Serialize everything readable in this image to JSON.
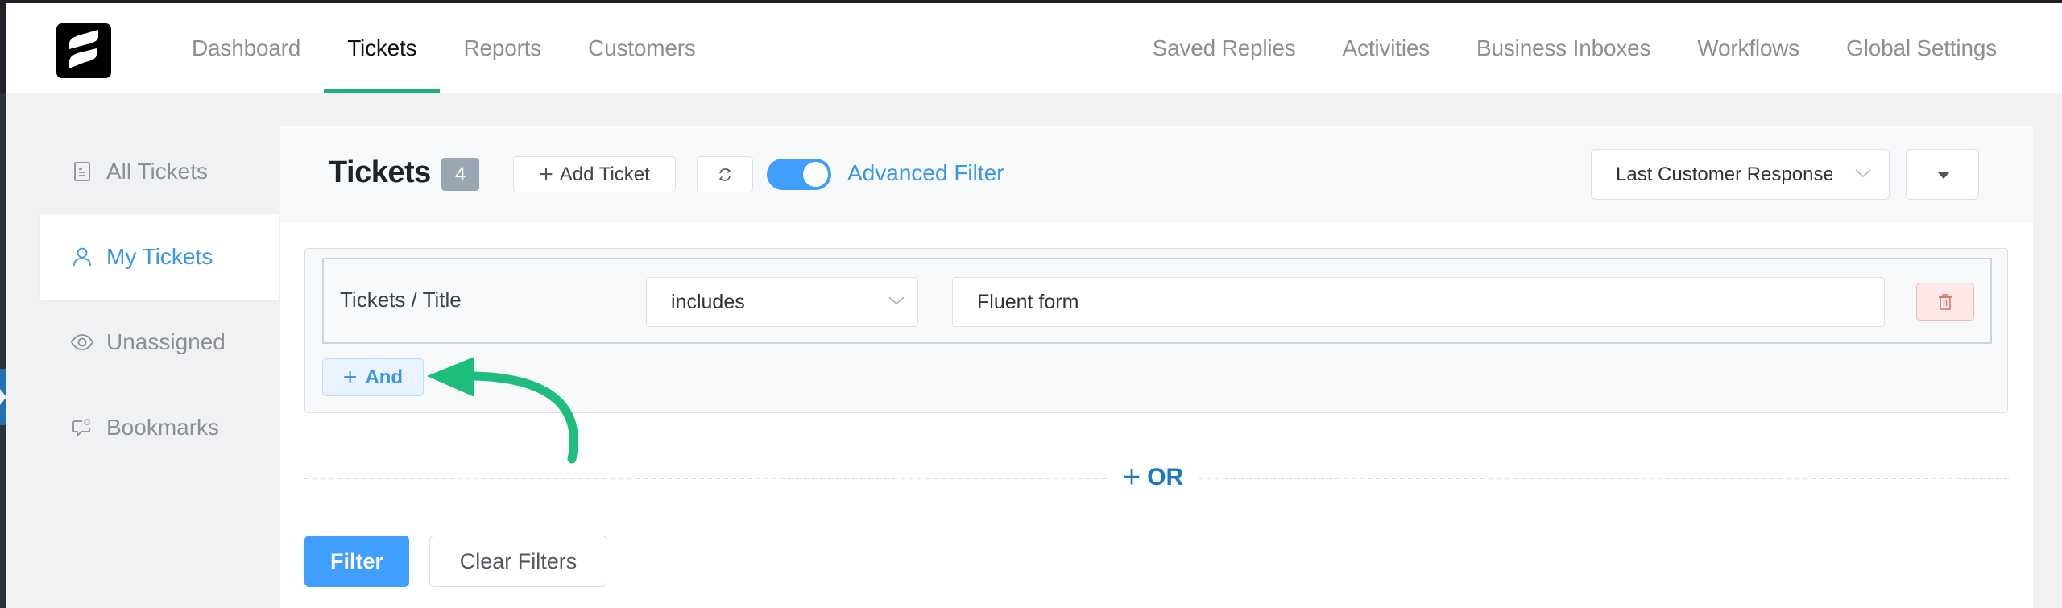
{
  "header": {
    "logo": "fluent-support-logo",
    "nav_left": [
      {
        "label": "Dashboard",
        "active": false
      },
      {
        "label": "Tickets",
        "active": true
      },
      {
        "label": "Reports",
        "active": false
      },
      {
        "label": "Customers",
        "active": false
      }
    ],
    "nav_right": [
      {
        "label": "Saved Replies"
      },
      {
        "label": "Activities"
      },
      {
        "label": "Business Inboxes"
      },
      {
        "label": "Workflows"
      },
      {
        "label": "Global Settings"
      }
    ]
  },
  "sidebar": {
    "items": [
      {
        "label": "All Tickets",
        "icon": "document-list-icon",
        "active": false
      },
      {
        "label": "My Tickets",
        "icon": "user-icon",
        "active": true
      },
      {
        "label": "Unassigned",
        "icon": "eye-icon",
        "active": false
      },
      {
        "label": "Bookmarks",
        "icon": "chat-at-icon",
        "active": false
      }
    ]
  },
  "toolbar": {
    "title": "Tickets",
    "count": "4",
    "add_ticket_label": "Add Ticket",
    "refresh_icon": "refresh-icon",
    "advanced_filter_label": "Advanced Filter",
    "advanced_filter_enabled": true,
    "sort_by_value": "Last Customer Response",
    "sort_order_icon": "caret-down-icon"
  },
  "filter": {
    "groups": [
      {
        "rules": [
          {
            "field": "Tickets / Title",
            "operator": "includes",
            "value": "Fluent form"
          }
        ],
        "and_label": "And"
      }
    ],
    "or_label": "OR",
    "filter_label": "Filter",
    "clear_label": "Clear Filters"
  },
  "annotation": {
    "type": "arrow",
    "color": "#1dbd7c",
    "points_to": "and-button"
  },
  "colors": {
    "accent_blue": "#409eff",
    "link_blue": "#3a96e6",
    "or_blue": "#1a78c2",
    "tab_underline": "#21b07a",
    "danger": "#e07070"
  }
}
